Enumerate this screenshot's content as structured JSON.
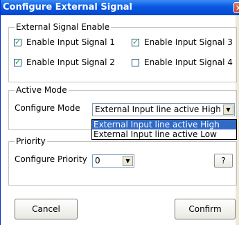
{
  "window": {
    "title": "Configure External Signal",
    "close_glyph": "x"
  },
  "signal_enable": {
    "legend": "External Signal Enable",
    "checkboxes": [
      {
        "label": "Enable Input Signal 1",
        "checked": true
      },
      {
        "label": "Enable Input Signal 3",
        "checked": true
      },
      {
        "label": "Enable Input Signal 2",
        "checked": true
      },
      {
        "label": "Enable Input Signal 4",
        "checked": false
      }
    ],
    "check_glyph": "✓"
  },
  "active_mode": {
    "legend": "Active Mode",
    "label": "Configure Mode",
    "selected": "External Input line active High",
    "options": [
      "External Input line active High",
      "External Input line active Low"
    ]
  },
  "priority": {
    "legend": "Priority",
    "label": "Configure Priority",
    "selected": "0",
    "help_label": "?"
  },
  "buttons": {
    "cancel": "Cancel",
    "confirm": "Confirm"
  },
  "dropdown_arrow": "▼",
  "colors": {
    "title_bar": "#0a58e0",
    "selection": "#316ac5",
    "check": "#21a121"
  }
}
